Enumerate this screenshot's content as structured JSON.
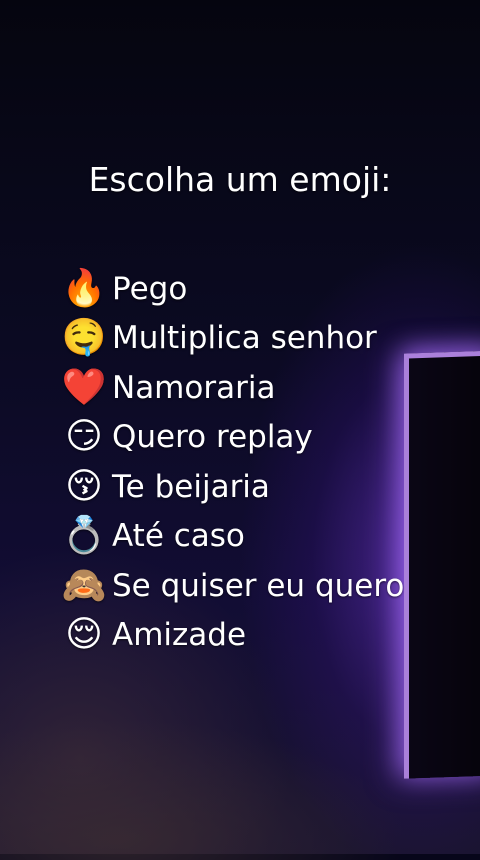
{
  "title": "Escolha um emoji:",
  "options": [
    {
      "emoji": "🔥",
      "icon": "fire-icon",
      "label": "Pego"
    },
    {
      "emoji": "🤤",
      "icon": "drooling-face-icon",
      "label": "Multiplica senhor"
    },
    {
      "emoji": "❤️",
      "icon": "red-heart-icon",
      "label": "Namoraria"
    },
    {
      "emoji": "😏",
      "icon": "smirking-face-icon",
      "label": "Quero replay"
    },
    {
      "emoji": "😚",
      "icon": "kissing-face-icon",
      "label": "Te beijaria"
    },
    {
      "emoji": "💍",
      "icon": "ring-icon",
      "label": "Até caso"
    },
    {
      "emoji": "🙈",
      "icon": "see-no-evil-monkey-icon",
      "label": "Se quiser eu quero"
    },
    {
      "emoji": "😌",
      "icon": "relieved-face-icon",
      "label": "Amizade"
    }
  ]
}
